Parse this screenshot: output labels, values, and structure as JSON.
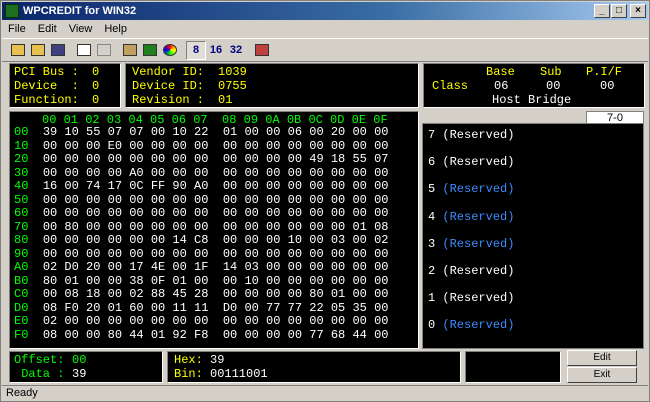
{
  "window": {
    "title": "WPCREDIT for WIN32"
  },
  "menu": [
    "File",
    "Edit",
    "View",
    "Help"
  ],
  "toolbar": {
    "bit8": "8",
    "bit16": "16",
    "bit32": "32"
  },
  "pci": {
    "bus_label": "PCI Bus :",
    "bus": "0",
    "device_label": "Device  :",
    "device": "0",
    "function_label": "Function:",
    "function": "0"
  },
  "ids": {
    "vendor_label": "Vendor ID:",
    "vendor": "1039",
    "device_label": "Device ID:",
    "device": "0755",
    "revision_label": "Revision :",
    "revision": "01"
  },
  "class": {
    "label": "Class",
    "base_label": "Base",
    "sub_label": "Sub",
    "pif_label": "P.I/F",
    "base": "06",
    "sub": "00",
    "pif": "00",
    "name": "Host Bridge"
  },
  "hex": {
    "header": "00 01 02 03 04 05 06 07  08 09 0A 0B 0C 0D 0E 0F",
    "rows": [
      {
        "addr": "00",
        "data": "39 10 55 07 07 00 10 22  01 00 00 06 00 20 00 00"
      },
      {
        "addr": "10",
        "data": "00 00 00 E0 00 00 00 00  00 00 00 00 00 00 00 00"
      },
      {
        "addr": "20",
        "data": "00 00 00 00 00 00 00 00  00 00 00 00 49 18 55 07"
      },
      {
        "addr": "30",
        "data": "00 00 00 00 A0 00 00 00  00 00 00 00 00 00 00 00"
      },
      {
        "addr": "40",
        "data": "16 00 74 17 0C FF 90 A0  00 00 00 00 00 00 00 00"
      },
      {
        "addr": "50",
        "data": "00 00 00 00 00 00 00 00  00 00 00 00 00 00 00 00"
      },
      {
        "addr": "60",
        "data": "00 00 00 00 00 00 00 00  00 00 00 00 00 00 00 00"
      },
      {
        "addr": "70",
        "data": "00 80 00 00 00 00 00 00  00 00 00 00 00 00 01 08"
      },
      {
        "addr": "80",
        "data": "00 00 00 00 00 00 14 C8  00 00 00 10 00 03 00 02"
      },
      {
        "addr": "90",
        "data": "00 00 00 00 00 00 00 00  00 00 00 00 00 00 00 00"
      },
      {
        "addr": "A0",
        "data": "02 D0 20 00 17 4E 00 1F  14 03 00 00 00 00 00 00"
      },
      {
        "addr": "B0",
        "data": "80 01 00 00 38 0F 01 00  00 10 00 00 00 00 00 00"
      },
      {
        "addr": "C0",
        "data": "00 08 18 00 02 88 45 28  00 00 00 00 80 01 00 00"
      },
      {
        "addr": "D0",
        "data": "08 F0 20 01 60 00 11 11  D0 00 77 77 22 05 35 00"
      },
      {
        "addr": "E0",
        "data": "02 00 00 00 00 00 00 00  00 00 00 00 00 00 00 00"
      },
      {
        "addr": "F0",
        "data": "08 00 00 80 44 01 92 F8  00 00 00 00 77 68 44 00"
      }
    ]
  },
  "bits": {
    "tab": "7-0",
    "items": [
      {
        "n": "7",
        "label": "(Reserved)"
      },
      {
        "n": "6",
        "label": "(Reserved)"
      },
      {
        "n": "5",
        "label": "(Reserved)"
      },
      {
        "n": "4",
        "label": "(Reserved)"
      },
      {
        "n": "3",
        "label": "(Reserved)"
      },
      {
        "n": "2",
        "label": "(Reserved)"
      },
      {
        "n": "1",
        "label": "(Reserved)"
      },
      {
        "n": "0",
        "label": "(Reserved)"
      }
    ]
  },
  "offset": {
    "offset_label": "Offset:",
    "offset": "00",
    "data_label": " Data :",
    "data": "39"
  },
  "value": {
    "hex_label": "Hex:",
    "hex": "39",
    "bin_label": "Bin:",
    "bin": "00111001"
  },
  "buttons": {
    "edit": "Edit",
    "exit": "Exit"
  },
  "status": "Ready"
}
